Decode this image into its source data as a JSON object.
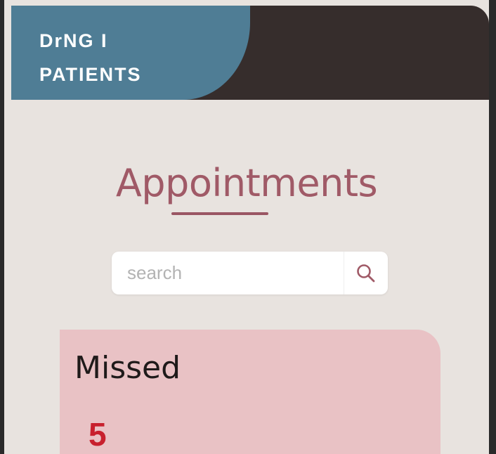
{
  "header": {
    "brand": "DrNG I\nPATIENTS"
  },
  "main": {
    "title": "Appointments",
    "search": {
      "placeholder": "search",
      "value": ""
    },
    "missed_card": {
      "label": "Missed",
      "count": "5"
    }
  },
  "icons": {
    "search": "search-icon"
  },
  "colors": {
    "header_bg": "#362d2c",
    "brand_panel": "#4f7d95",
    "page_bg": "#e8e3df",
    "title": "#a05a67",
    "missed_card_bg": "#e9c2c5",
    "missed_count": "#c8202e"
  }
}
